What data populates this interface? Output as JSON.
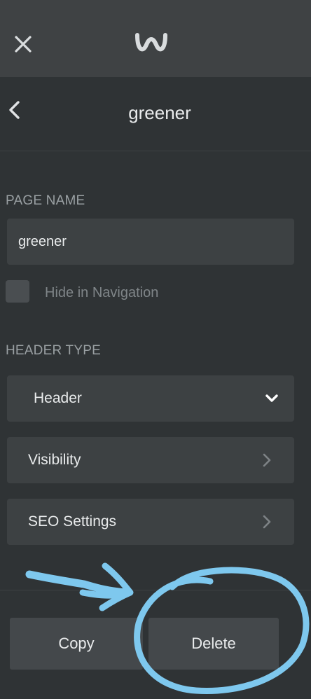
{
  "topbar": {
    "close_icon": "close-icon",
    "logo_icon": "weebly-logo-icon"
  },
  "panel": {
    "title": "greener",
    "page_name_label": "PAGE NAME",
    "page_name_value": "greener",
    "hide_nav_label": "Hide in Navigation",
    "hide_nav_checked": false,
    "header_type_label": "HEADER TYPE",
    "header_type_value": "Header",
    "visibility_label": "Visibility",
    "seo_label": "SEO Settings",
    "copy_label": "Copy",
    "delete_label": "Delete"
  },
  "colors": {
    "annotation": "#7ec8ee",
    "panel_bg": "#2f3335",
    "field_bg": "#3d4143"
  }
}
